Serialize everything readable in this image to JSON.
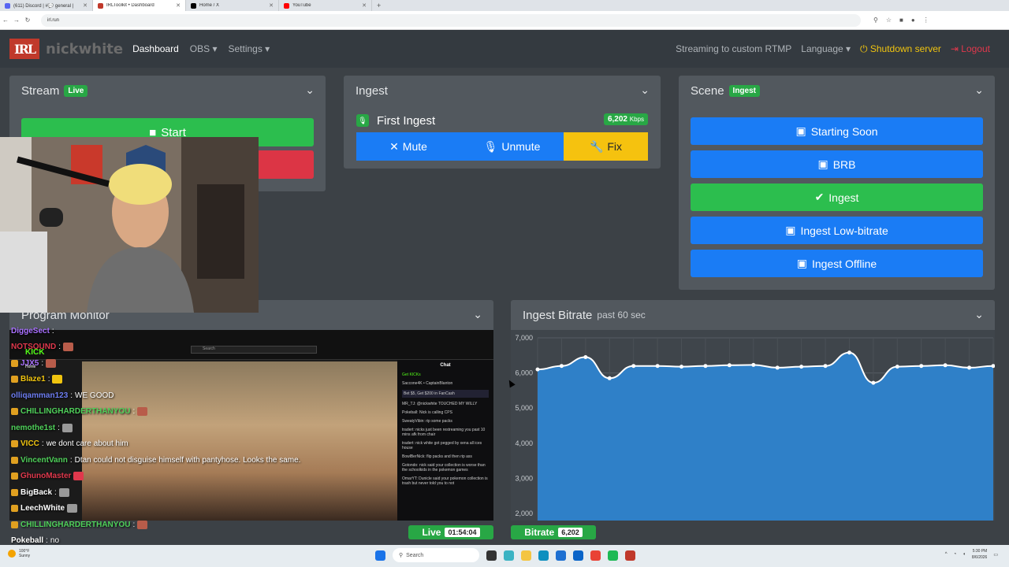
{
  "browser": {
    "tabs": [
      {
        "label": "(611) Discord | #💬 general | ",
        "color": "#5865f2",
        "active": false
      },
      {
        "label": "IRLToolkit • Dashboard",
        "color": "#c0392b",
        "active": true
      },
      {
        "label": "Home / X",
        "color": "#000000",
        "active": false
      },
      {
        "label": "YouTube",
        "color": "#ff0000",
        "active": false
      }
    ],
    "url": "irl.run"
  },
  "navbar": {
    "logo_mark": "IRL",
    "username": "nickwhite",
    "dashboard": "Dashboard",
    "obs": "OBS ▾",
    "settings": "Settings ▾",
    "streaming_status": "Streaming to custom RTMP",
    "language": "Language ▾",
    "shutdown": "Shutdown server",
    "logout": "Logout"
  },
  "stream_card": {
    "title": "Stream",
    "badge": "Live",
    "start_label": "Start",
    "stop_label": ""
  },
  "ingest_card": {
    "title": "Ingest",
    "ingest_name": "First Ingest",
    "kbps_value": "6,202",
    "kbps_unit": "Kbps",
    "mute": "Mute",
    "unmute": "Unmute",
    "fix": "Fix"
  },
  "scene_card": {
    "title": "Scene",
    "badge": "Ingest",
    "buttons": [
      {
        "label": "Starting Soon",
        "color": "#1a7cf5"
      },
      {
        "label": "BRB",
        "color": "#1a7cf5"
      },
      {
        "label": "Ingest",
        "color": "#2cbe4e"
      },
      {
        "label": "Ingest Low-bitrate",
        "color": "#1a7cf5"
      },
      {
        "label": "Ingest Offline",
        "color": "#1a7cf5"
      }
    ]
  },
  "program_monitor": {
    "title": "Program Monitor",
    "search_placeholder": "Search",
    "chat_title": "Chat",
    "chat_lines": [
      "Get KICKs",
      "Saccone4K • CaptainBlanton",
      "Bet $5, Get $200 in FanCash",
      "MR_TJ: @nickwhite TOUCHED MY WILLY",
      "Pokeball: Nick is calling CPS",
      "SweatyVibin: rip some packs",
      "tradert: nicks just been restreaming you past 10 mins afk from chair",
      "tradert: nick white got pegged by xena all ices house",
      "BowlBerNick: flip packs and then rip ass",
      "Gotondo: nick said your collection is worse than the schoolkids in the pokemon games",
      "OmarYT: Dunicle said your pokemon collection is trash but never told you to not"
    ]
  },
  "overlay_chat": [
    {
      "user": "DiggeSect",
      "msg": "",
      "color": "#a970ff"
    },
    {
      "user": "NOTSOUND",
      "msg": "",
      "color": "#e0384c"
    },
    {
      "user": "JJX5",
      "msg": "",
      "color": "#a970ff"
    },
    {
      "user": "Blaze1",
      "msg": "",
      "color": "#f0c40f"
    },
    {
      "user": "olliqamman123",
      "msg": "WE GOOD",
      "color": "#6c7cf0"
    },
    {
      "user": "CHILLINGHARDERTHANYOU",
      "msg": "",
      "color": "#4fd15a"
    },
    {
      "user": "nemothe1st",
      "msg": "",
      "color": "#4fd15a"
    },
    {
      "user": "VICC",
      "msg": "we dont care about him",
      "color": "#f0c40f"
    },
    {
      "user": "VincentVann",
      "msg": "Dtan could not disguise himself with pantyhose. Looks the same.",
      "color": "#4fd15a"
    },
    {
      "user": "GhunoMaster",
      "msg": "",
      "color": "#e0384c"
    },
    {
      "user": "BigBack",
      "msg": "",
      "color": "#ffffff"
    },
    {
      "user": "LeechWhite",
      "msg": "",
      "color": "#ffffff"
    },
    {
      "user": "CHILLINGHARDERTHANYOU",
      "msg": "",
      "color": "#4fd15a"
    },
    {
      "user": "Pokeball",
      "msg": "no",
      "color": "#ffffff"
    }
  ],
  "overlay_chat_labels": [
    "KICK",
    "Home"
  ],
  "bitrate_card": {
    "title": "Ingest Bitrate",
    "subtitle": "past 60 sec"
  },
  "chart_data": {
    "type": "area",
    "title": "Ingest Bitrate",
    "subtitle": "past 60 sec",
    "xlabel": "",
    "ylabel": "",
    "ylim": [
      1800,
      7000
    ],
    "yticks": [
      "7,000",
      "6,000",
      "5,000",
      "4,000",
      "3,000",
      "2,000"
    ],
    "ytick_values": [
      7000,
      6000,
      5000,
      4000,
      3000,
      2000
    ],
    "series": [
      {
        "values": [
          6100,
          6200,
          6450,
          5850,
          6200,
          6200,
          6180,
          6200,
          6220,
          6230,
          6150,
          6180,
          6200,
          6580,
          5720,
          6180,
          6200,
          6220,
          6150,
          6200
        ],
        "color": "#2f80c8"
      }
    ],
    "grid": true
  },
  "footer": {
    "live_label": "Live",
    "live_time": "01:54:04",
    "bitrate_label": "Bitrate",
    "bitrate_value": "6,202"
  },
  "taskbar": {
    "weather_temp": "100°F",
    "weather_desc": "Sunny",
    "search": "Search",
    "time": "5:30 PM",
    "date": "8/6/2026"
  }
}
